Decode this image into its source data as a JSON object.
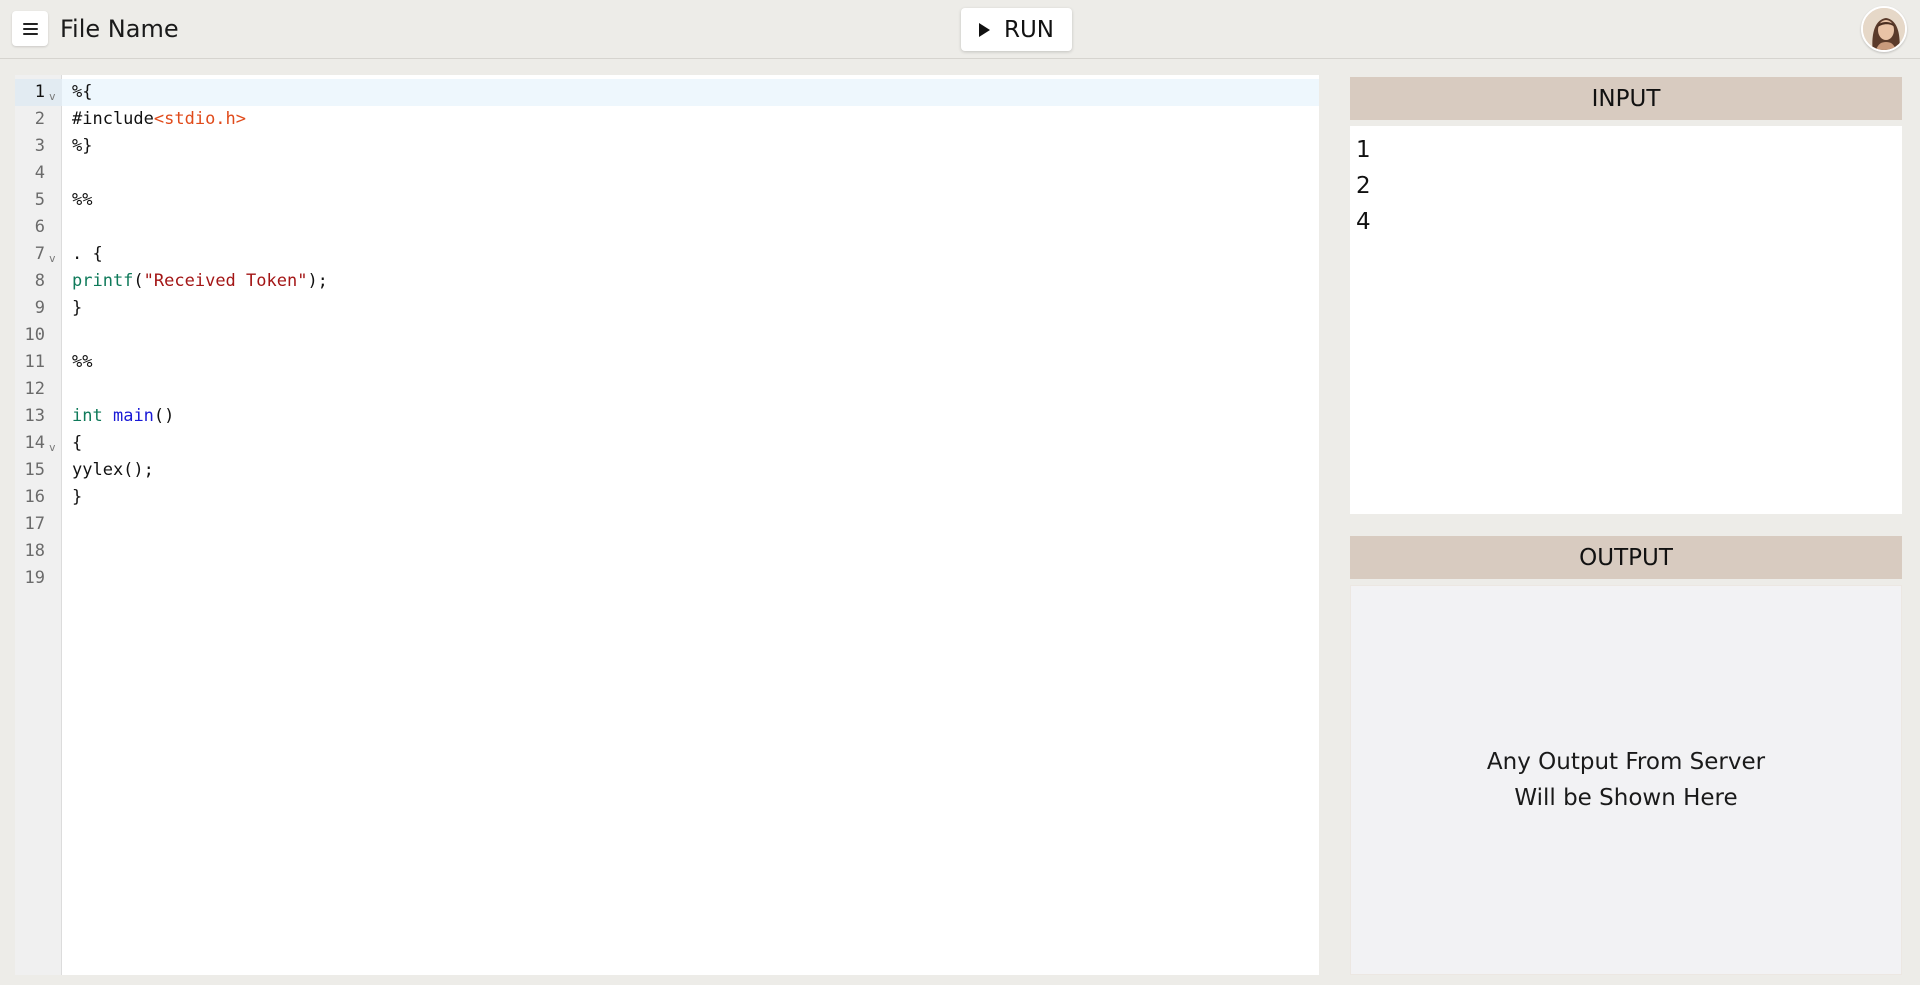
{
  "header": {
    "file_name": "File Name",
    "run_label": "RUN",
    "menu_icon": "hamburger-menu-icon",
    "play_icon": "play-icon",
    "avatar": "user-avatar"
  },
  "editor": {
    "language": "lex",
    "active_line": "1",
    "line_numbers": [
      "1",
      "2",
      "3",
      "4",
      "5",
      "6",
      "7",
      "8",
      "9",
      "10",
      "11",
      "12",
      "13",
      "14",
      "15",
      "16",
      "17",
      "18",
      "19"
    ],
    "fold_markers": [
      "1",
      "7",
      "14"
    ],
    "lines": [
      "%{",
      "#include",
      "<stdio.h>",
      "%}",
      "%%",
      ". {",
      "printf",
      "(",
      "\"Received Token\"",
      ");",
      "}",
      "%%",
      "int",
      "main",
      "()",
      "{",
      "yylex();",
      "}"
    ]
  },
  "input": {
    "title": "INPUT",
    "lines": [
      "1",
      "2",
      "4"
    ]
  },
  "output": {
    "title": "OUTPUT",
    "placeholder_line1": "Any Output From Server",
    "placeholder_line2": "Will be Shown Here"
  },
  "colors": {
    "background": "#edece8",
    "panel_header": "#d8cbc0",
    "keyword": "#0f7a5a",
    "function": "#1a1ad6",
    "string": "#a31515",
    "include_path": "#e04a1a"
  }
}
